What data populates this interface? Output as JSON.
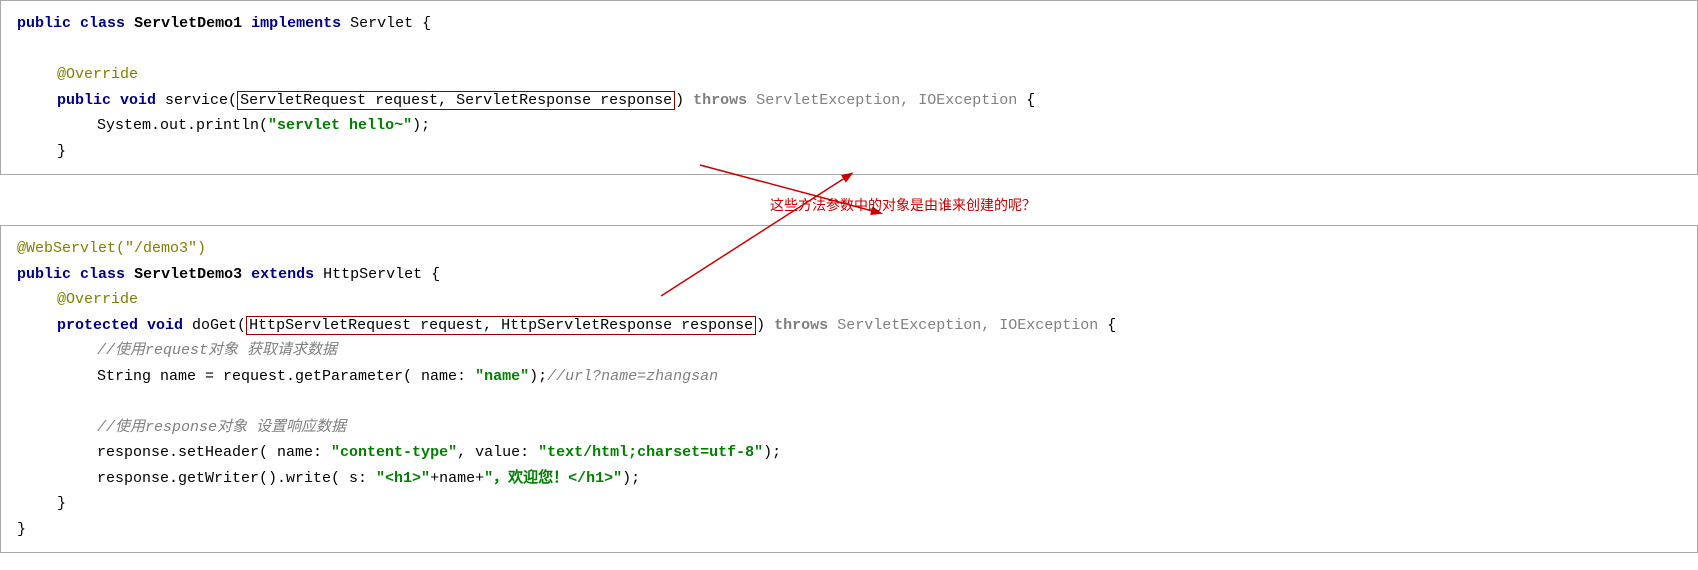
{
  "panel1": {
    "lines": [
      {
        "id": "p1l1",
        "type": "code"
      },
      {
        "id": "p1l2",
        "type": "blank"
      },
      {
        "id": "p1l3",
        "type": "annotation"
      },
      {
        "id": "p1l4",
        "type": "service"
      },
      {
        "id": "p1l5",
        "type": "body"
      },
      {
        "id": "p1l6",
        "type": "close"
      }
    ]
  },
  "panel2": {
    "lines": []
  },
  "annotation": {
    "chinese_text": "这些方法参数中的对象是由谁来创建的呢？"
  }
}
